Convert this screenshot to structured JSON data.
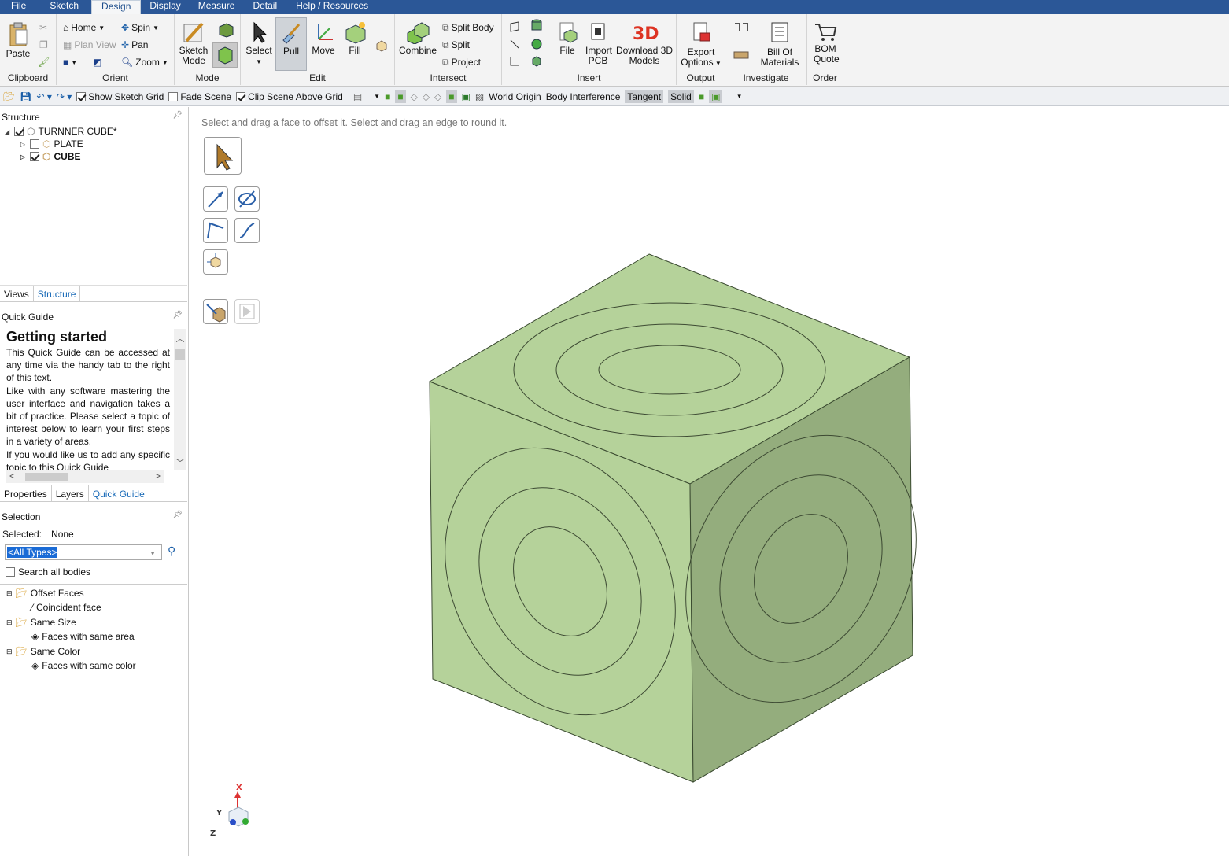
{
  "menu": [
    "File",
    "Sketch",
    "Design",
    "Display",
    "Measure",
    "Detail",
    "Help / Resources"
  ],
  "menu_active": "Design",
  "ribbon": {
    "clipboard": {
      "paste": "Paste",
      "label": "Clipboard"
    },
    "orient": {
      "home": "Home",
      "spin": "Spin",
      "plan_view": "Plan View",
      "pan": "Pan",
      "zoom": "Zoom",
      "label": "Orient"
    },
    "mode": {
      "sketch_mode": "Sketch Mode",
      "label": "Mode"
    },
    "edit": {
      "select": "Select",
      "pull": "Pull",
      "move": "Move",
      "fill": "Fill",
      "label": "Edit"
    },
    "intersect": {
      "combine": "Combine",
      "split_body": "Split Body",
      "split": "Split",
      "project": "Project",
      "label": "Intersect"
    },
    "insert": {
      "file": "File",
      "import_pcb": "Import PCB",
      "download": "Download 3D Models",
      "label": "Insert"
    },
    "output": {
      "export": "Export Options",
      "label": "Output"
    },
    "investigate": {
      "bom": "Bill Of Materials",
      "label": "Investigate"
    },
    "order": {
      "bom_quote": "BOM Quote",
      "label": "Order"
    }
  },
  "qat": {
    "show_sketch_grid": "Show Sketch Grid",
    "fade_scene": "Fade Scene",
    "clip_scene": "Clip Scene Above Grid",
    "world_origin": "World Origin",
    "body_interference": "Body Interference",
    "tangent": "Tangent",
    "solid": "Solid"
  },
  "structure": {
    "title": "Structure",
    "root": "TURNNER CUBE*",
    "items": [
      "PLATE",
      "CUBE"
    ]
  },
  "panel_tabs1": [
    "Views",
    "Structure"
  ],
  "quick_guide": {
    "title": "Quick Guide",
    "heading": "Getting started",
    "paragraphs": [
      "This Quick Guide can be accessed at any time via the handy tab to the right of this text.",
      "Like with any software mastering the user interface and navigation takes a bit of practice. Please select a topic of interest below to learn your first steps in a variety of areas.",
      "If you would like us to add any specific topic to this Quick Guide"
    ]
  },
  "panel_tabs2": [
    "Properties",
    "Layers",
    "Quick Guide"
  ],
  "selection": {
    "title": "Selection",
    "selected_label": "Selected:",
    "selected_value": "None",
    "filter": "<All Types>",
    "search_all": "Search all bodies",
    "groups": [
      {
        "name": "Offset Faces",
        "child": "Coincident face"
      },
      {
        "name": "Same Size",
        "child": "Faces with same area"
      },
      {
        "name": "Same Color",
        "child": "Faces with same color"
      }
    ]
  },
  "viewport": {
    "hint": "Select and drag a face to offset it. Select and drag an edge to round it.",
    "axes": {
      "x": "X",
      "y": "Y",
      "z": "Z"
    }
  },
  "colors": {
    "menubar": "#2b5797",
    "face_top": "#b5d29a",
    "face_left": "#b5d29a",
    "face_right": "#94ad7d"
  }
}
